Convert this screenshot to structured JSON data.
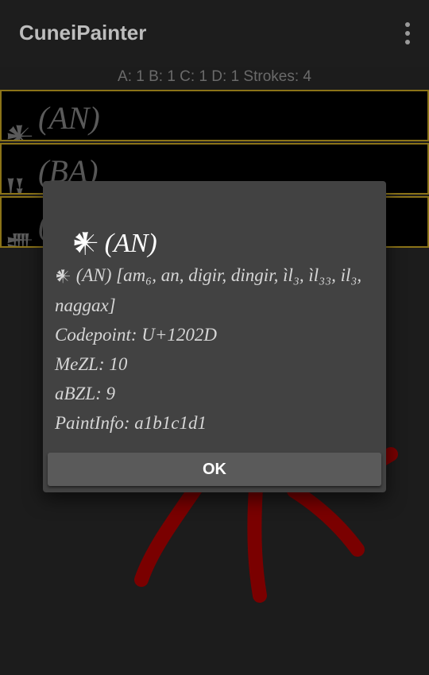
{
  "app": {
    "title": "CuneiPainter"
  },
  "status": {
    "text": "A: 1 B: 1 C: 1 D: 1 Strokes: 4"
  },
  "sign_list": [
    {
      "glyph": "𒀭",
      "label": "(AN)"
    },
    {
      "glyph": "𒀀",
      "label": "(BA)"
    },
    {
      "glyph": "𒌑",
      "label": "("
    }
  ],
  "dialog": {
    "title_glyph": "𒀭",
    "title_label": "(AN)",
    "body_glyph": "𒀭",
    "body_line1": "(AN) [am₆, an, digir, dingir, ìl₃, ìl₃₃, il₃, naggax]",
    "codepoint": "Codepoint: U+1202D",
    "mezl": "MeZL: 10",
    "abzl": "aBZL: 9",
    "paintinfo": "PaintInfo: a1b1c1d1",
    "ok_label": "OK"
  },
  "colors": {
    "row_border": "#8b7318",
    "stroke": "#7a0000",
    "dialog_bg": "#424242"
  }
}
